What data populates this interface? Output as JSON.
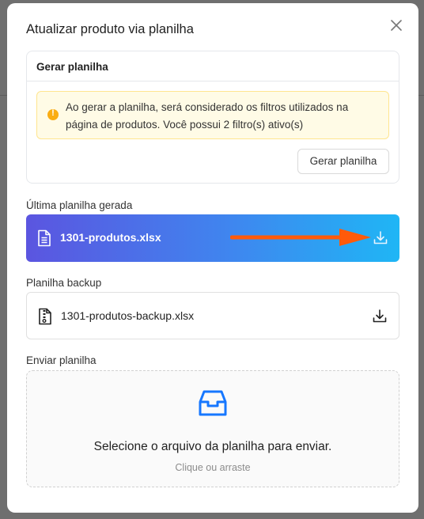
{
  "modal": {
    "title": "Atualizar produto via planilha"
  },
  "generate": {
    "header": "Gerar planilha",
    "alert_text": "Ao gerar a planilha, será considerado os filtros utilizados na página de produtos. Você possui 2 filtro(s) ativo(s)",
    "button_label": "Gerar planilha"
  },
  "last_generated": {
    "label": "Última planilha gerada",
    "file_name": "1301-produtos.xlsx"
  },
  "backup": {
    "label": "Planilha backup",
    "file_name": "1301-produtos-backup.xlsx"
  },
  "upload": {
    "label": "Enviar planilha",
    "main_text": "Selecione o arquivo da planilha para enviar.",
    "sub_text": "Clique ou arraste"
  },
  "colors": {
    "accent_blue": "#1677ff",
    "warning": "#faad14",
    "annotation_arrow": "#ff5a0a",
    "gradient_start": "#5b55e0",
    "gradient_end": "#1fb6f5"
  },
  "icons": [
    "close-icon",
    "warning-icon",
    "file-spreadsheet-icon",
    "download-icon",
    "file-zip-icon",
    "inbox-icon"
  ]
}
